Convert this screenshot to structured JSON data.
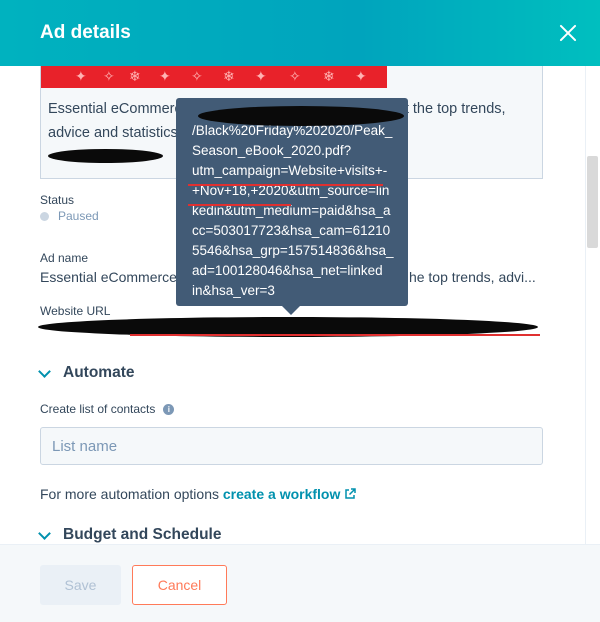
{
  "header": {
    "title": "Ad details",
    "close_icon": "close-icon"
  },
  "ad_preview": {
    "text_line1_start": "Essential eCommerce",
    "text_line1_end": "t the top trends,",
    "text_line2": "advice and statistics"
  },
  "status": {
    "label": "Status",
    "value": "Paused"
  },
  "ad_name": {
    "label": "Ad name",
    "value_start": "Essential eCommerce",
    "value_end": "he top trends, advi..."
  },
  "website_url": {
    "label": "Website URL"
  },
  "automate": {
    "heading": "Automate",
    "list_label": "Create list of contacts",
    "list_placeholder": "List name",
    "note_text": "For more automation options",
    "note_link": "create a workflow"
  },
  "budget": {
    "heading": "Budget and Schedule"
  },
  "footer": {
    "save_label": "Save",
    "cancel_label": "Cancel"
  },
  "tooltip": {
    "lines": [
      "/Black%20Friday%202020/Peak_",
      "Season_eBook_2020.pdf?",
      "utm_campaign=Website+visits+-",
      "+Nov+18,+2020&utm_source=lin",
      "kedin&utm_medium=paid&hsa_a",
      "cc=503017723&hsa_cam=61210",
      "5546&hsa_grp=157514836&hsa_",
      "ad=100128046&hsa_net=linked",
      "in&hsa_ver=3"
    ]
  },
  "colors": {
    "accent": "#00a4bd",
    "link": "#0091ae",
    "cancel": "#ff7a59",
    "tooltip_bg": "#425b76"
  }
}
